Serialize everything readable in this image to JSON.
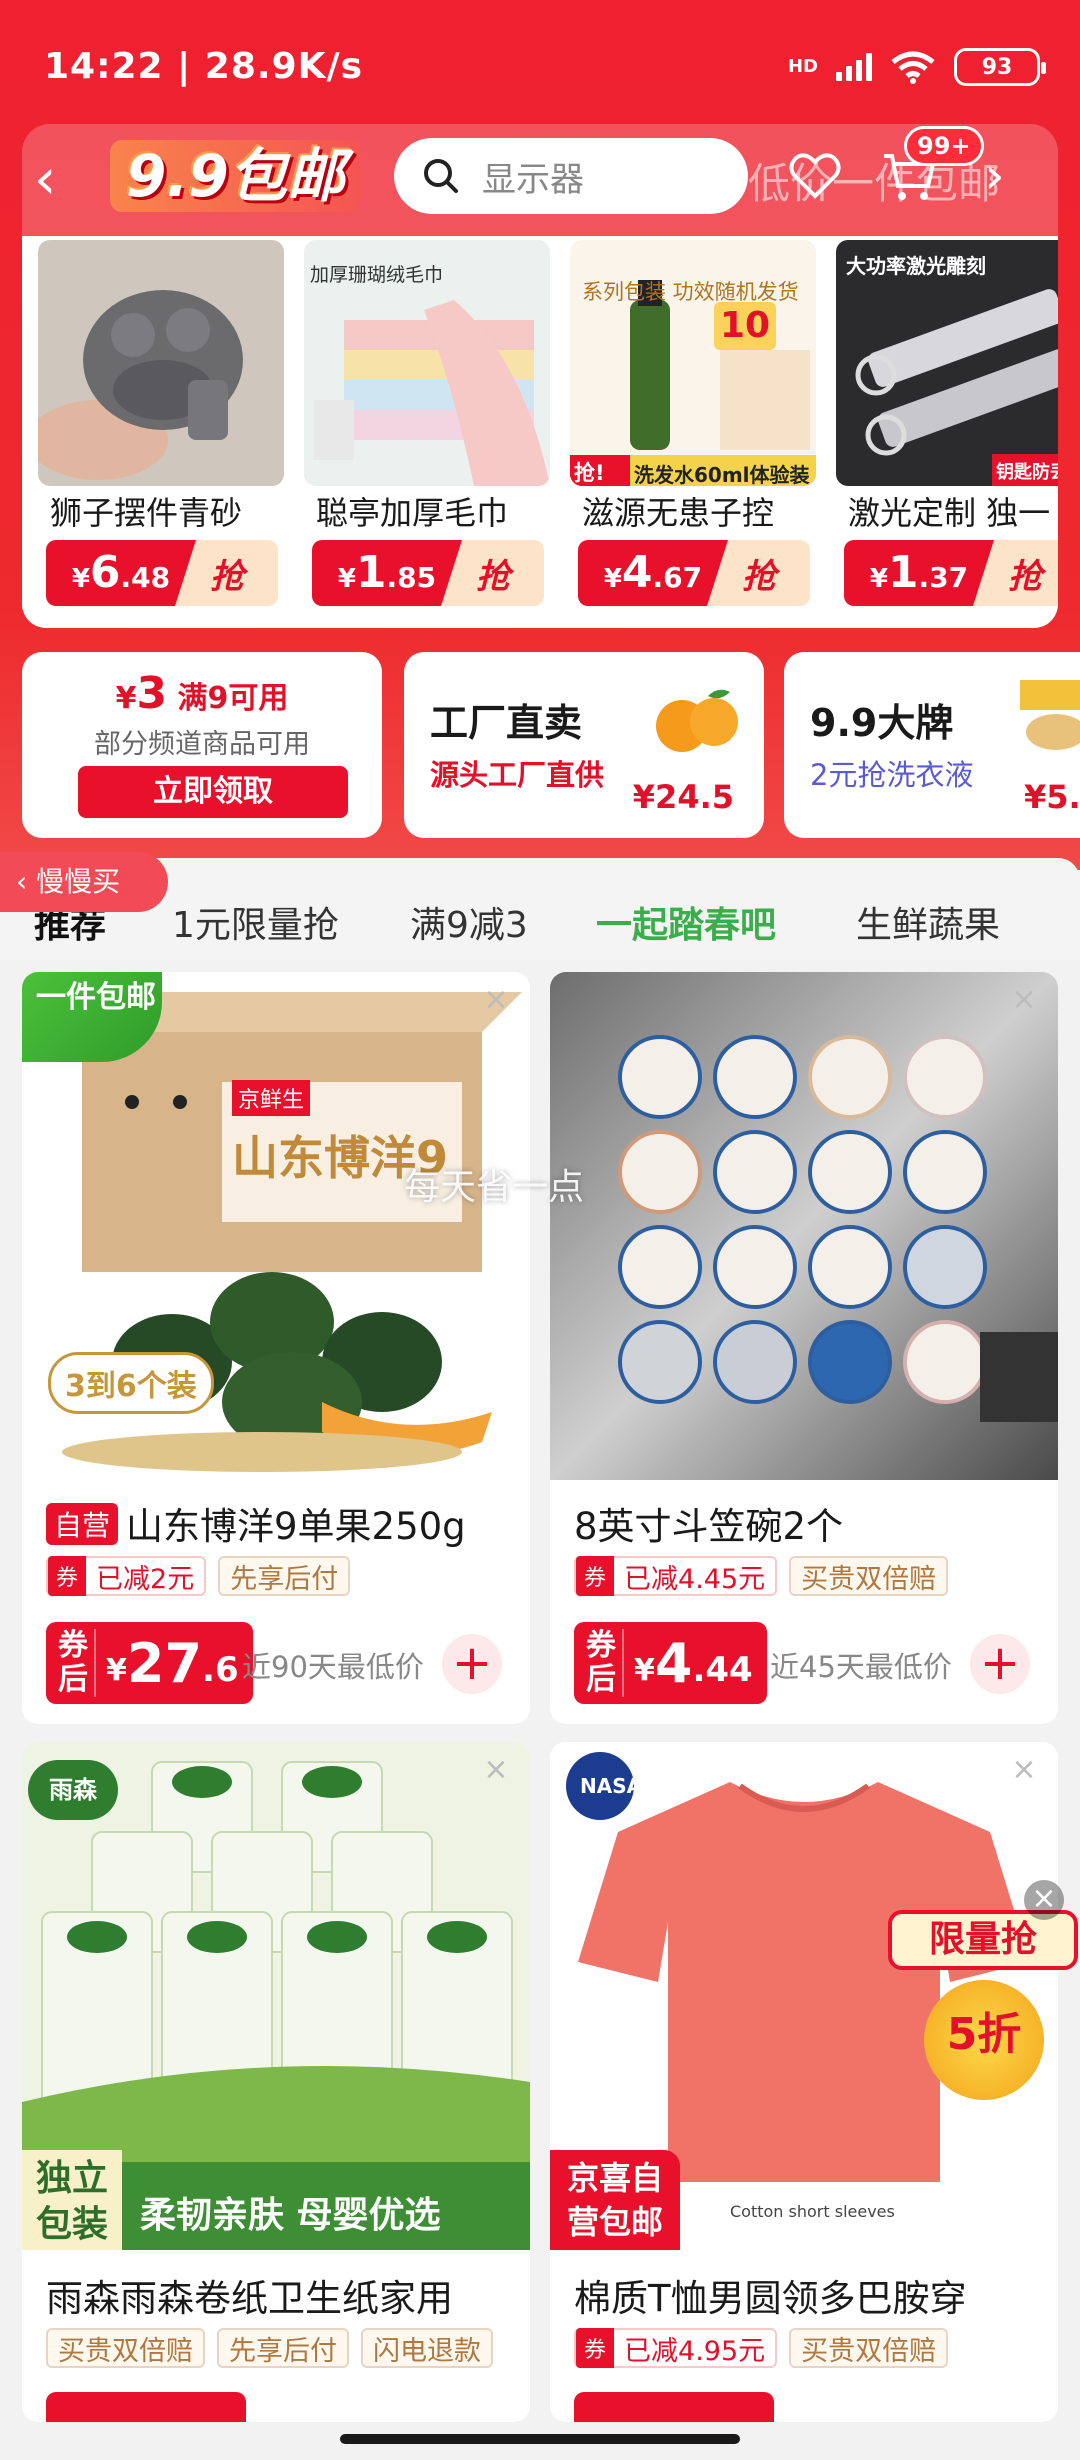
{
  "status": {
    "time": "14:22 | 28.9K/s",
    "network": "HD",
    "battery": "93"
  },
  "nav": {
    "promo_label": "9.9包邮",
    "search_placeholder": "显示器",
    "faded_text": "低价一件包邮",
    "cart_badge": "99+"
  },
  "deals": [
    {
      "name": "狮子摆件青砂",
      "yuan": "6",
      "cents": ".48",
      "cta": "抢"
    },
    {
      "name": "聪亭加厚毛巾",
      "yuan": "1",
      "cents": ".85",
      "cta": "抢"
    },
    {
      "name": "滋源无患子控",
      "yuan": "4",
      "cents": ".67",
      "cta": "抢"
    },
    {
      "name": "激光定制 独一",
      "yuan": "1",
      "cents": ".37",
      "cta": "抢"
    }
  ],
  "deal_images": {
    "towel_header": "加厚珊瑚绒毛巾",
    "shampoo_top": "系列包装 功效随机发货",
    "shampoo_price": "10",
    "shampoo_grab": "抢!",
    "shampoo_bottom": "洗发水60ml体验装",
    "laser_header": "大功率激光雕刻",
    "laser_tag": "钥匙防丢"
  },
  "coupon": {
    "symbol": "¥",
    "amount": "3",
    "condition": "满9可用",
    "desc": "部分频道商品可用",
    "button": "立即领取"
  },
  "factory": {
    "title": "工厂直卖",
    "sub": "源头工厂直供",
    "price": "¥24.5"
  },
  "brand": {
    "title": "9.9大牌",
    "sub": "2元抢洗衣液",
    "price": "¥5."
  },
  "slow_buy": "慢慢买",
  "tabs": [
    "推荐",
    "1元限量抢",
    "满9减3",
    "一起踏春吧",
    "生鲜蔬果"
  ],
  "watermark": "每天省一点",
  "products": [
    {
      "corner": "一件包邮",
      "self": "自营",
      "title": "山东博洋9单果250g",
      "tags": [
        {
          "q": "券",
          "text": "已减2元"
        },
        {
          "text": "先享后付"
        }
      ],
      "coupon_label": "券后",
      "yuan": "27",
      "cents": ".6",
      "low": "近90天最低价",
      "box_text": "山东博洋9",
      "box_brand": "京鲜生",
      "badge_text": "3到6个装"
    },
    {
      "title": "8英寸斗笠碗2个",
      "tags": [
        {
          "q": "券",
          "text": "已减4.45元"
        },
        {
          "text": "买贵双倍赔"
        }
      ],
      "coupon_label": "券后",
      "yuan": "4",
      "cents": ".44",
      "low": "近45天最低价"
    },
    {
      "title": "雨森雨森卷纸卫生纸家用",
      "tags": [
        {
          "text": "买贵双倍赔"
        },
        {
          "text": "先享后付"
        },
        {
          "text": "闪电退款"
        }
      ],
      "brand": "雨森",
      "corner": "独立包装",
      "banner": "柔韧亲肤 母婴优选"
    },
    {
      "title": "棉质T恤男圆领多巴胺穿",
      "tags": [
        {
          "q": "券",
          "text": "已减4.95元"
        },
        {
          "text": "买贵双倍赔"
        }
      ],
      "corner": "京喜自营包邮",
      "shirt_caption": "Cotton short sleeves",
      "logo": "NASA"
    }
  ],
  "float_promo": {
    "title": "限量抢",
    "discount": "5折"
  },
  "colors": {
    "primary": "#e8102a",
    "green_tab": "#3aae4a"
  }
}
